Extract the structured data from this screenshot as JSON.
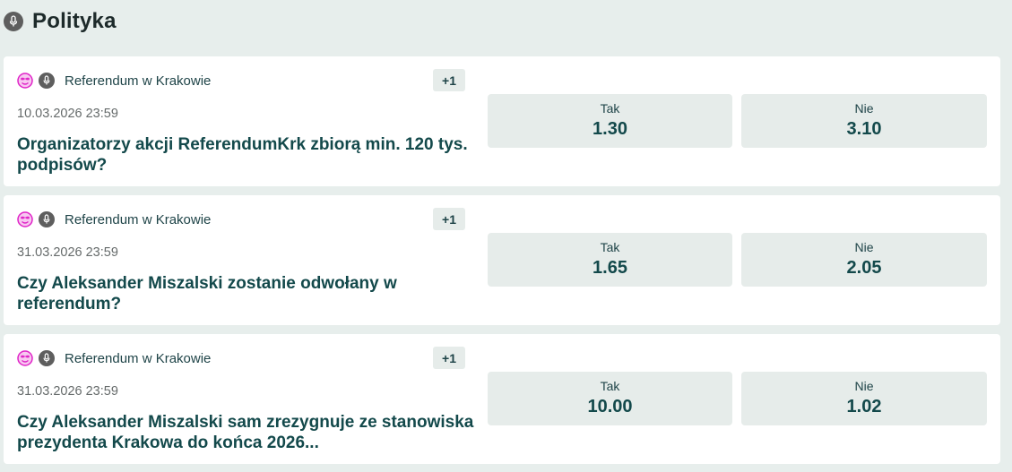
{
  "section": {
    "icon": "microphone-icon",
    "title": "Polityka"
  },
  "markets": [
    {
      "category": "Referendum w Krakowie",
      "extra_markets": "+1",
      "date": "10.03.2026 23:59",
      "question": "Organizatorzy akcji ReferendumKrk zbiorą min. 120 tys. podpisów?",
      "options": [
        {
          "label": "Tak",
          "odds": "1.30"
        },
        {
          "label": "Nie",
          "odds": "3.10"
        }
      ]
    },
    {
      "category": "Referendum w Krakowie",
      "extra_markets": "+1",
      "date": "31.03.2026 23:59",
      "question": "Czy Aleksander Miszalski zostanie odwołany w referendum?",
      "options": [
        {
          "label": "Tak",
          "odds": "1.65"
        },
        {
          "label": "Nie",
          "odds": "2.05"
        }
      ]
    },
    {
      "category": "Referendum w Krakowie",
      "extra_markets": "+1",
      "date": "31.03.2026 23:59",
      "question": "Czy Aleksander Miszalski sam zrezygnuje ze stanowiska prezydenta Krakowa do końca 2026...",
      "options": [
        {
          "label": "Tak",
          "odds": "10.00"
        },
        {
          "label": "Nie",
          "odds": "1.02"
        }
      ]
    }
  ],
  "colors": {
    "background": "#e7eeec",
    "card": "#ffffff",
    "button": "#e6ecea",
    "primary_text": "#13494b",
    "emoji_accent": "#e024c8",
    "icon_gray": "#5e5e5e"
  },
  "icons": [
    "microphone-icon",
    "emoji-face-icon"
  ]
}
